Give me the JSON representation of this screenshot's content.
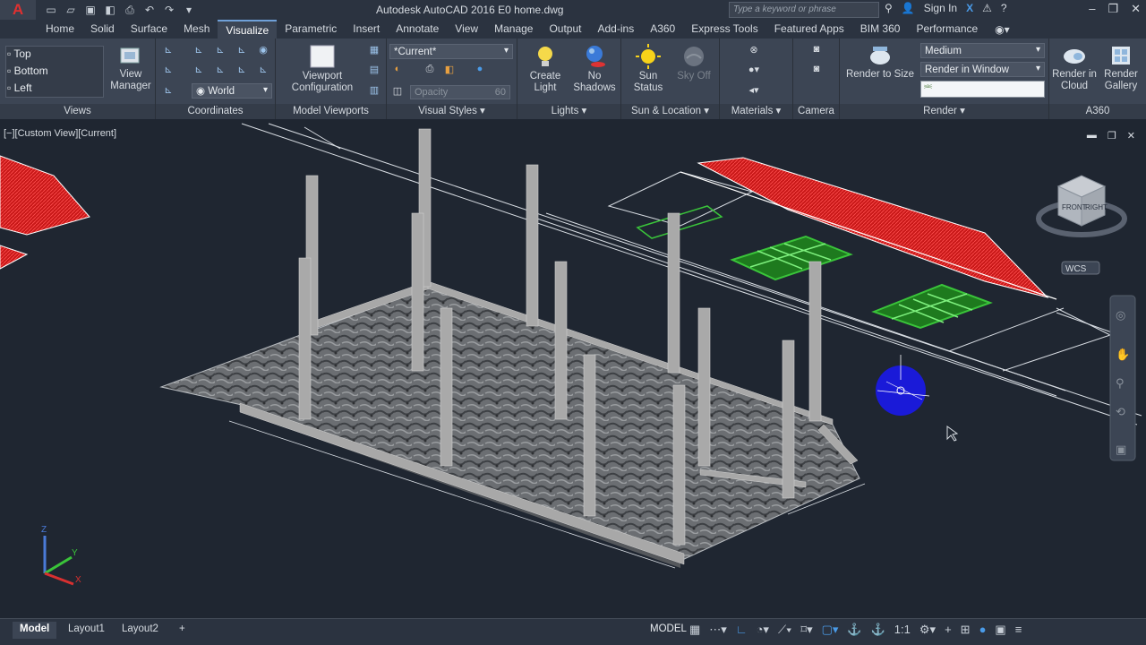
{
  "app": {
    "title": "Autodesk AutoCAD 2016    E0 home.dwg",
    "search_placeholder": "Type a keyword or phrase",
    "sign_in": "Sign In",
    "logo_letter": "A"
  },
  "tabs": [
    "Home",
    "Solid",
    "Surface",
    "Mesh",
    "Visualize",
    "Parametric",
    "Insert",
    "Annotate",
    "View",
    "Manage",
    "Output",
    "Add-ins",
    "A360",
    "Express Tools",
    "Featured Apps",
    "BIM 360",
    "Performance"
  ],
  "active_tab": "Visualize",
  "ribbon": {
    "views": {
      "label": "Views",
      "items": [
        "Top",
        "Bottom",
        "Left"
      ],
      "view_manager": "View\nManager"
    },
    "coordinates": {
      "label": "Coordinates",
      "ucs_value": "World"
    },
    "model_viewports": {
      "label": "Model Viewports",
      "viewport_config": "Viewport\nConfiguration"
    },
    "visual_styles": {
      "label": "Visual Styles",
      "current": "*Current*",
      "opacity_label": "Opacity",
      "opacity_value": "60"
    },
    "lights": {
      "label": "Lights",
      "create_light": "Create\nLight",
      "no_shadows": "No\nShadows"
    },
    "sun_location": {
      "label": "Sun & Location",
      "sun_status": "Sun\nStatus",
      "sky_off": "Sky Off"
    },
    "materials": {
      "label": "Materials"
    },
    "camera": {
      "label": "Camera"
    },
    "render": {
      "label": "Render",
      "render_to_size": "Render to Size",
      "quality": "Medium",
      "render_mode": "Render in Window"
    },
    "a360": {
      "label": "A360",
      "render_cloud": "Render in\nCloud",
      "render_gallery": "Render\nGallery"
    }
  },
  "viewport": {
    "label": "[−][Custom View][Current]",
    "viewcube_front": "FRONT",
    "viewcube_right": "RIGHT",
    "wcs": "WCS",
    "axis_x": "X",
    "axis_y": "Y",
    "axis_z": "Z"
  },
  "statusbar": {
    "layout_tabs": [
      "Model",
      "Layout1",
      "Layout2"
    ],
    "active_layout": "Model",
    "add_tab": "+",
    "model_badge": "MODEL",
    "scale": "1:1"
  },
  "colors": {
    "background": "#1f2631",
    "ribbon": "#3c4554",
    "accent_blue": "#4a9be8",
    "roof_red": "#cc1f1f",
    "window_green": "#3ac43a"
  }
}
